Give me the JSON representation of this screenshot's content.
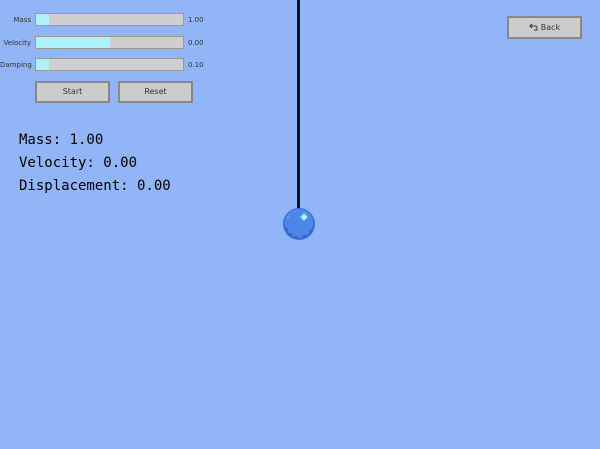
{
  "controls": {
    "mass": {
      "label": "Mass",
      "value_text": "1.00",
      "fill_fraction": 0.09
    },
    "velocity": {
      "label": "Velocity",
      "value_text": "0.00",
      "fill_fraction": 0.5
    },
    "damping": {
      "label": "Damping",
      "value_text": "0.10",
      "fill_fraction": 0.09
    },
    "start_label": "Start",
    "reset_label": "Reset"
  },
  "back_button": {
    "label": "Back",
    "icon": "return-arrow-icon"
  },
  "readouts": {
    "mass": "Mass: 1.00",
    "velocity": "Velocity: 0.00",
    "displacement": "Displacement: 0.00"
  },
  "colors": {
    "background": "#92b5f8",
    "slider_fill": "#aef1fb",
    "slider_track": "#cfcfcf",
    "bob": "#4d83ea",
    "rope": "#111111"
  }
}
